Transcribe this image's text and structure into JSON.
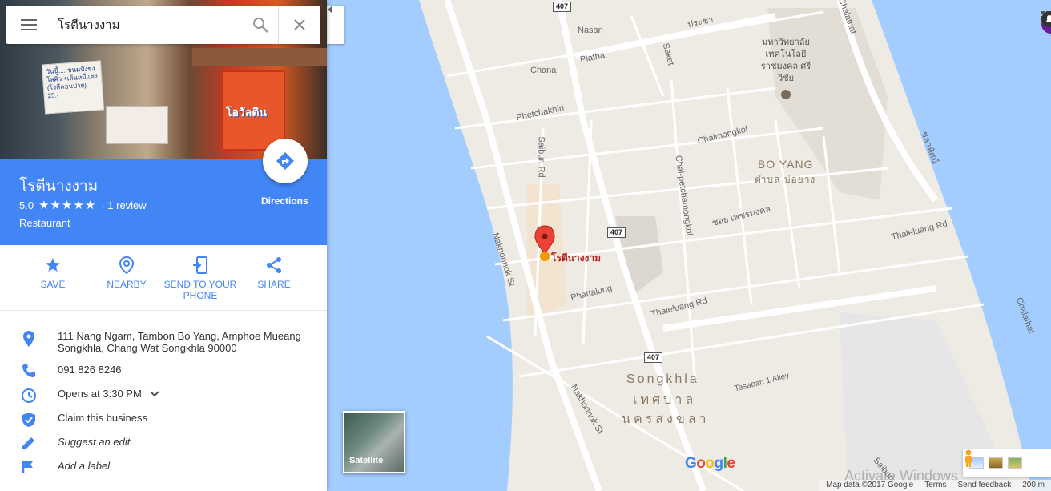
{
  "search": {
    "query": "โรตีนางงาม"
  },
  "place": {
    "name": "โรตีนางงาม",
    "rating": "5.0",
    "stars": "★★★★★",
    "reviews": "· 1 review",
    "category": "Restaurant",
    "directions_label": "Directions"
  },
  "photo": {
    "sign_text": "วันนี้.... ขนมปังชงโลศิ๋ว +เส้นหมี่แต่ง (โรตีคอนปาย) 25.-",
    "banner_text": "โอวัลติน"
  },
  "actions": [
    {
      "label": "SAVE"
    },
    {
      "label": "NEARBY"
    },
    {
      "label": "SEND TO YOUR PHONE"
    },
    {
      "label": "SHARE"
    }
  ],
  "info": {
    "address": "111 Nang Ngam, Tambon Bo Yang, Amphoe Mueang Songkhla, Chang Wat Songkhla 90000",
    "phone": "091 826 8246",
    "hours": "Opens at 3:30 PM",
    "claim": "Claim this business",
    "suggest": "Suggest an edit",
    "label": "Add a label"
  },
  "map": {
    "roads": {
      "nasan": "Nasan",
      "platha": "Platha",
      "chana": "Chana",
      "saket": "Saket",
      "pracha": "ประชา",
      "petchakhiri": "Phetchakhiri",
      "saiburi": "Saiburi Rd",
      "chaimongkol": "Chaimongkol",
      "chaipetch": "Chai-petchamongkol",
      "phetmongkol": "ซอย เพชรมงคล",
      "nakhonnok": "Nakhonnok St",
      "nakhonnok2": "Nakhonnok St",
      "phattalung": "Phattalung",
      "thaleluang": "Thaleluang Rd",
      "thaleluang2": "Thaleluang Rd",
      "tesaban": "Tesaban 1 Alley",
      "chalathat": "Chalathat",
      "chalathat2": "Chalathat",
      "chalathat_th": "ชลาทัศน์",
      "saiburi2": "Saiburi"
    },
    "route_shields": [
      "407",
      "407",
      "407"
    ],
    "areas": {
      "boyang_en": "BO YANG",
      "boyang_th": "ตำบล บ่อยาง",
      "songkhla_en": "Songkhla",
      "songkhla_th1": "เทศบาล",
      "songkhla_th2": "นครสงขลา"
    },
    "institution": "มหาวิทยาลัย เทคโนโลยี ราชมงคล ศรีวิชัย",
    "poi_label": "โรตีนางงาม",
    "satellite_label": "Satellite",
    "logo": "Google",
    "activate": "Activate Windows",
    "footer": {
      "data": "Map data ©2017 Google",
      "terms": "Terms",
      "feedback": "Send feedback",
      "scale": "200 m"
    }
  },
  "colors": {
    "header_blue": "#4285f4",
    "water": "#a3ccff",
    "land": "#eeebe5",
    "pin": "#ea4335",
    "hours_red": "#d93025"
  }
}
